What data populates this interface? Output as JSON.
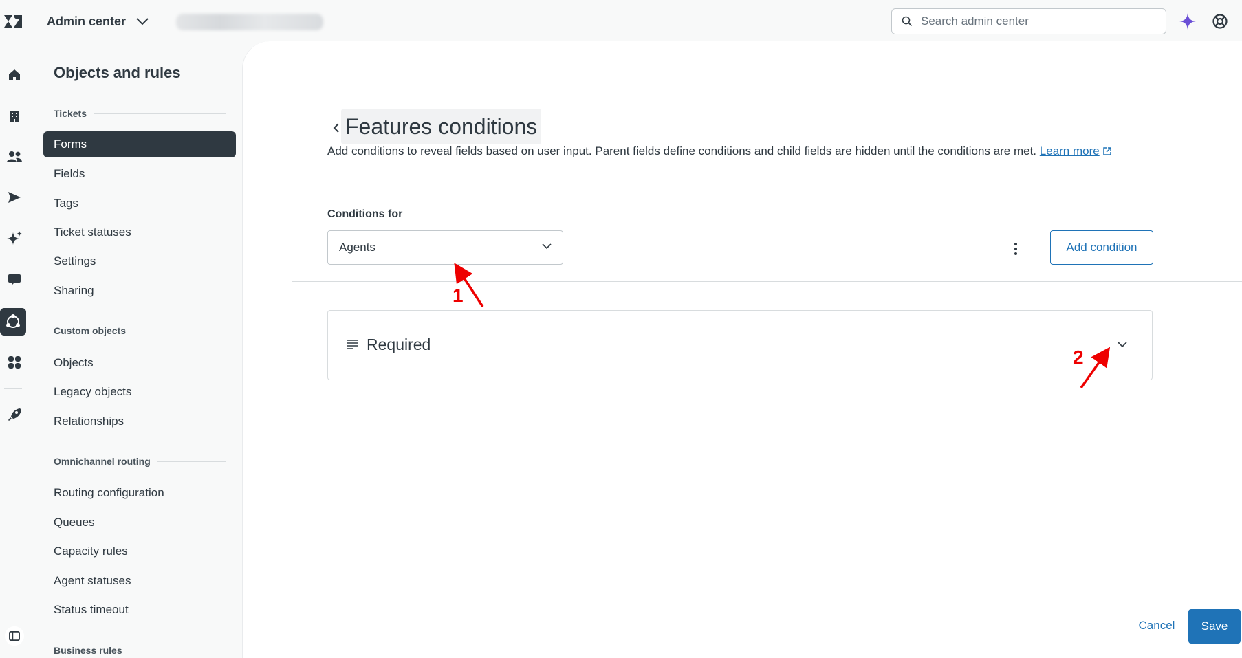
{
  "header": {
    "product_name": "Admin center",
    "search_placeholder": "Search admin center"
  },
  "rail": {
    "icons": [
      "home-icon",
      "building-icon",
      "people-icon",
      "send-icon",
      "sparkle-icon",
      "chat-icon",
      "objects-icon",
      "apps-icon",
      "rocket-icon"
    ]
  },
  "sidebar": {
    "title": "Objects and rules",
    "sections": [
      {
        "header": "Tickets",
        "items": [
          "Forms",
          "Fields",
          "Tags",
          "Ticket statuses",
          "Settings",
          "Sharing"
        ]
      },
      {
        "header": "Custom objects",
        "items": [
          "Objects",
          "Legacy objects",
          "Relationships"
        ]
      },
      {
        "header": "Omnichannel routing",
        "items": [
          "Routing configuration",
          "Queues",
          "Capacity rules",
          "Agent statuses",
          "Status timeout"
        ]
      },
      {
        "header": "Business rules",
        "items": []
      }
    ],
    "active_item": "Forms"
  },
  "main": {
    "title": "Features conditions",
    "description": "Add conditions to reveal fields based on user input. Parent fields define conditions and child fields are hidden until the conditions are met.",
    "learn_more": "Learn more",
    "conditions_for_label": "Conditions for",
    "conditions_for_value": "Agents",
    "add_condition_label": "Add condition",
    "accordion_label": "Required",
    "cancel_label": "Cancel",
    "save_label": "Save"
  },
  "annotations": {
    "marker_1": "1",
    "marker_2": "2"
  },
  "colors": {
    "accent": "#1f73b7",
    "active_nav": "#2f3941",
    "annotation": "#ee0000",
    "ai_icon": "#6a4fd6"
  }
}
